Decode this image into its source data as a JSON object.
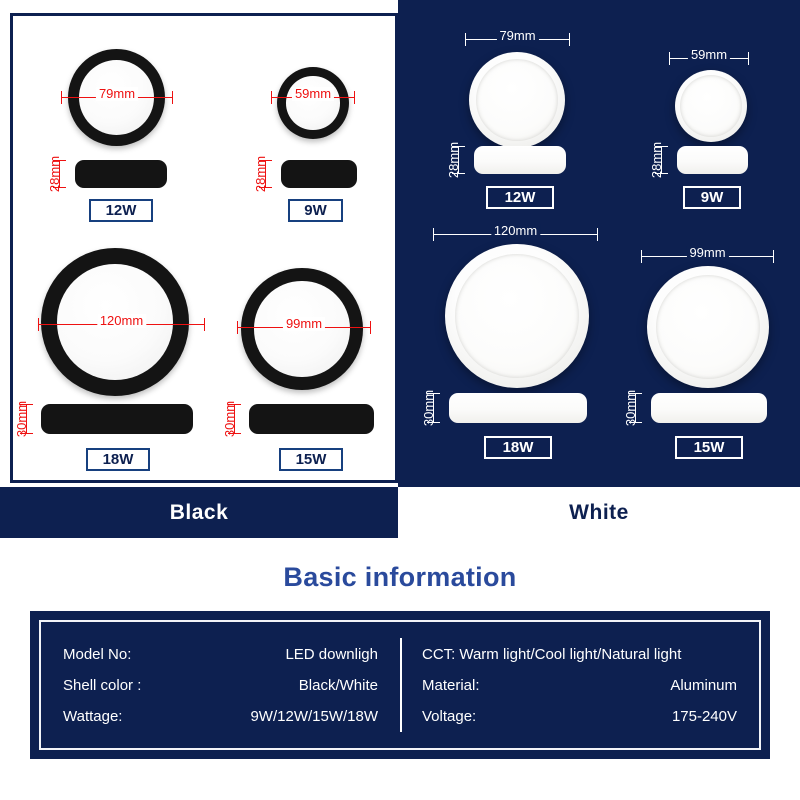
{
  "panels": {
    "black": {
      "color_label": "Black",
      "fixtures": [
        {
          "watt": "12W",
          "diameter": "79mm",
          "height": "28mm"
        },
        {
          "watt": "9W",
          "diameter": "59mm",
          "height": "28mm"
        },
        {
          "watt": "18W",
          "diameter": "120mm",
          "height": "30mm"
        },
        {
          "watt": "15W",
          "diameter": "99mm",
          "height": "30mm"
        }
      ]
    },
    "white": {
      "color_label": "White",
      "fixtures": [
        {
          "watt": "12W",
          "diameter": "79mm",
          "height": "28mm"
        },
        {
          "watt": "9W",
          "diameter": "59mm",
          "height": "28mm"
        },
        {
          "watt": "18W",
          "diameter": "120mm",
          "height": "30mm"
        },
        {
          "watt": "15W",
          "diameter": "99mm",
          "height": "30mm"
        }
      ]
    }
  },
  "info": {
    "title": "Basic information",
    "left_rows": [
      {
        "key": "Model No:",
        "value": "LED downligh"
      },
      {
        "key": "Shell color :",
        "value": "Black/White"
      },
      {
        "key": "Wattage:",
        "value": "9W/12W/15W/18W"
      }
    ],
    "right_rows": [
      {
        "key": "CCT:",
        "value": "Warm light/Cool light/Natural light"
      },
      {
        "key": "Material:",
        "value": "Aluminum"
      },
      {
        "key": "Voltage:",
        "value": "175-240V"
      }
    ]
  },
  "colors": {
    "navy": "#0d2050",
    "accent_title": "#2a4a9c",
    "dimension_red": "#ee1111",
    "dimension_white": "#ffffff",
    "shell_black": "#141414"
  }
}
